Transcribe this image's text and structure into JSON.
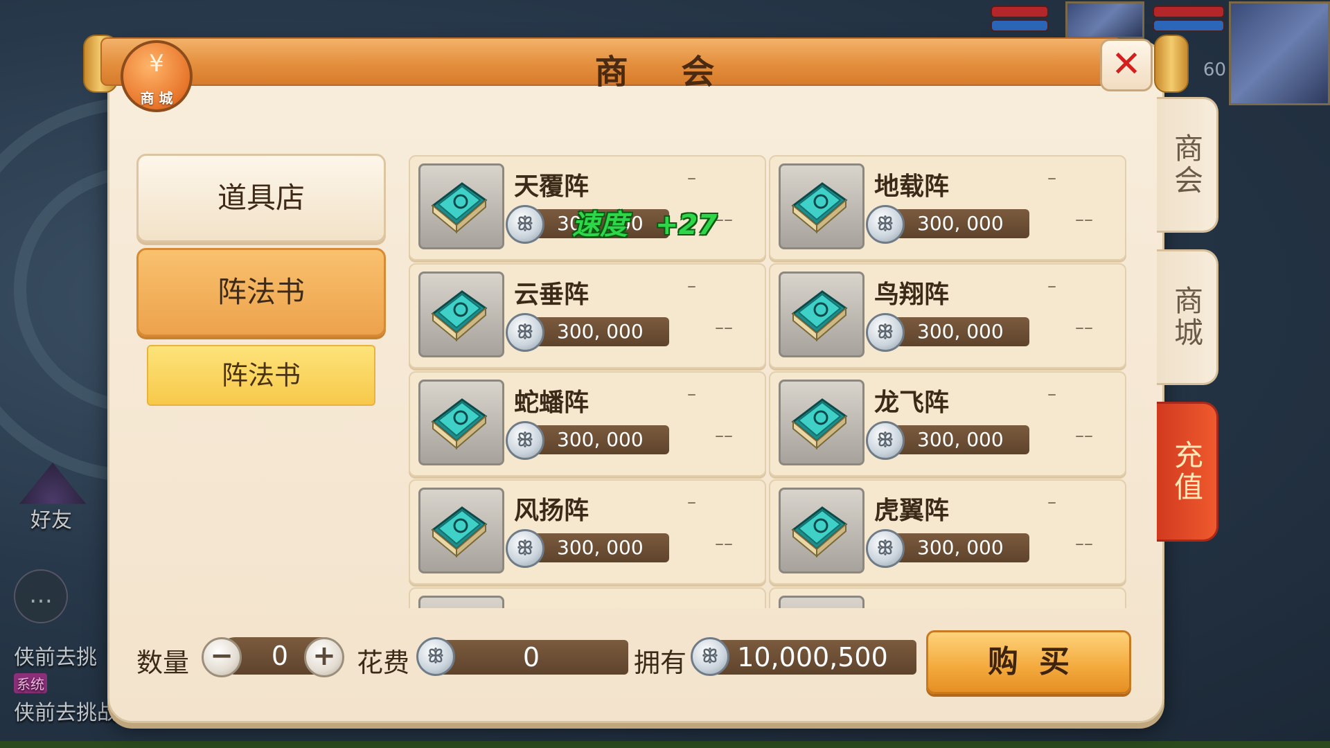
{
  "window": {
    "title": "商 会",
    "mall_icon_label": "商 城",
    "mall_icon_glyph": "¥",
    "close_glyph": "✕"
  },
  "hud": {
    "level": "60",
    "friend_label": "好友",
    "chat_lines": [
      "侠前去挑",
      "侠前去挑战"
    ],
    "system_tag": "系统",
    "chat_icon": "…"
  },
  "side_tabs": {
    "chamber": "商会",
    "mall": "商城",
    "recharge": "充值"
  },
  "categories": [
    {
      "label": "道具店"
    },
    {
      "label": "阵法书"
    }
  ],
  "subcategory": {
    "label": "阵法书"
  },
  "coin_glyph": "ꕥ",
  "tooltip": {
    "text": "速度",
    "value": "+27"
  },
  "items": [
    {
      "name": "天覆阵",
      "price": "300, 000",
      "dash1": "–",
      "dash2": "––"
    },
    {
      "name": "地载阵",
      "price": "300, 000",
      "dash1": "–",
      "dash2": "––"
    },
    {
      "name": "云垂阵",
      "price": "300, 000",
      "dash1": "–",
      "dash2": "––"
    },
    {
      "name": "鸟翔阵",
      "price": "300, 000",
      "dash1": "–",
      "dash2": "––"
    },
    {
      "name": "蛇蟠阵",
      "price": "300, 000",
      "dash1": "–",
      "dash2": "––"
    },
    {
      "name": "龙飞阵",
      "price": "300, 000",
      "dash1": "–",
      "dash2": "––"
    },
    {
      "name": "风扬阵",
      "price": "300, 000",
      "dash1": "–",
      "dash2": "––"
    },
    {
      "name": "虎翼阵",
      "price": "300, 000",
      "dash1": "–",
      "dash2": "––"
    }
  ],
  "footer": {
    "quantity_label": "数量",
    "quantity_value": "0",
    "minus": "−",
    "plus": "+",
    "cost_label": "花费",
    "cost_value": "0",
    "owned_label": "拥有",
    "owned_value": "10,000,500",
    "buy_label": "购买"
  },
  "colors": {
    "accent": "#eda24c",
    "price_bg": "#5e432c",
    "tooltip_green": "#2ed64a"
  }
}
